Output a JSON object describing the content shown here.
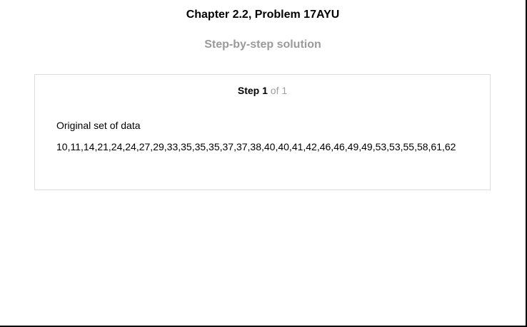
{
  "header": {
    "title": "Chapter 2.2, Problem 17AYU",
    "subtitle": "Step-by-step solution"
  },
  "step": {
    "label": "Step",
    "number": "1",
    "of_text": "of 1",
    "body_label": "Original set of data",
    "body_data": "10,11,14,21,24,24,27,29,33,35,35,35,37,37,38,40,40,41,42,46,46,49,49,53,53,55,58,61,62"
  },
  "colors": {
    "subtitle": "#9a9a9a",
    "step_of": "#a0a0a0",
    "card_border": "#dcdcdc"
  }
}
